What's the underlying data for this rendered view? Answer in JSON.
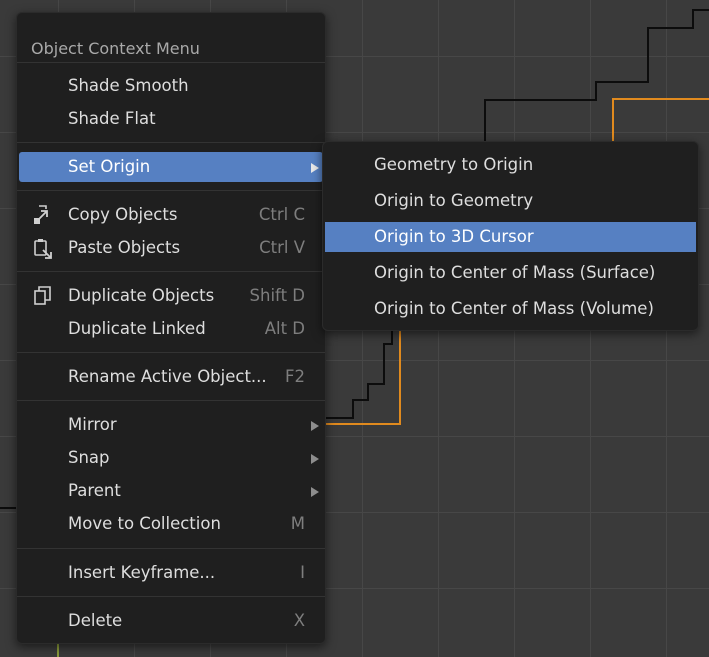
{
  "context_menu": {
    "title": "Object Context Menu",
    "items": [
      {
        "label": "Shade Smooth",
        "shortcut": ""
      },
      {
        "label": "Shade Flat",
        "shortcut": ""
      },
      {
        "label": "Set Origin",
        "shortcut": "",
        "submenu": true,
        "selected": true
      },
      {
        "label": "Copy Objects",
        "shortcut": "Ctrl C",
        "icon": "copy-icon"
      },
      {
        "label": "Paste Objects",
        "shortcut": "Ctrl V",
        "icon": "paste-icon"
      },
      {
        "label": "Duplicate Objects",
        "shortcut": "Shift D",
        "icon": "duplicate-icon"
      },
      {
        "label": "Duplicate Linked",
        "shortcut": "Alt D"
      },
      {
        "label": "Rename Active Object...",
        "shortcut": "F2"
      },
      {
        "label": "Mirror",
        "shortcut": "",
        "submenu": true
      },
      {
        "label": "Snap",
        "shortcut": "",
        "submenu": true
      },
      {
        "label": "Parent",
        "shortcut": "",
        "submenu": true
      },
      {
        "label": "Move to Collection",
        "shortcut": "M"
      },
      {
        "label": "Insert Keyframe...",
        "shortcut": "I"
      },
      {
        "label": "Delete",
        "shortcut": "X"
      }
    ]
  },
  "set_origin_submenu": {
    "items": [
      {
        "label": "Geometry to Origin"
      },
      {
        "label": "Origin to Geometry"
      },
      {
        "label": "Origin to 3D Cursor",
        "selected": true
      },
      {
        "label": "Origin to Center of Mass (Surface)"
      },
      {
        "label": "Origin to Center of Mass (Volume)"
      }
    ]
  },
  "colors": {
    "menu_background": "#1f1f1f",
    "highlight": "#5680c2",
    "viewport_background": "#3a3a3a",
    "grid_line": "#474747",
    "selection_outline": "#e08a1e"
  }
}
